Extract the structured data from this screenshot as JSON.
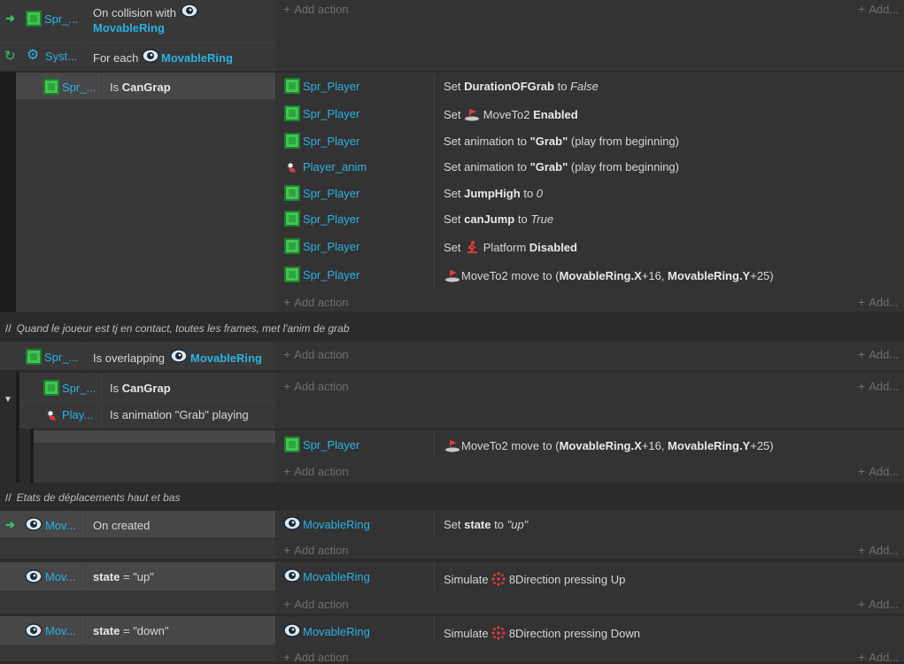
{
  "block1": {
    "trigger1": {
      "obj": "Spr_...",
      "text": "On collision with",
      "target": "MovableRing"
    },
    "trigger2": {
      "obj": "Syst...",
      "text": "For each",
      "target": "MovableRing"
    },
    "add_action": "Add action",
    "add_more": "Add..."
  },
  "sub1": {
    "cond_obj": "Spr_...",
    "cond_pre": "Is",
    "cond_var": "CanGrap",
    "actions": [
      {
        "obj": "Spr_Player",
        "icon": "sprite-icon",
        "pre": "Set",
        "a": "DurationOFGrab",
        "mid": "to",
        "b": "False"
      },
      {
        "obj": "Spr_Player",
        "icon": "sprite-icon",
        "pre": "Set",
        "beh": "MoveTo2",
        "b": "Enabled"
      },
      {
        "obj": "Spr_Player",
        "icon": "sprite-icon",
        "pre": "Set animation to",
        "a": "\"Grab\"",
        "post": "(play from beginning)"
      },
      {
        "obj": "Player_anim",
        "icon": "anim-icon",
        "pre": "Set animation to",
        "a": "\"Grab\"",
        "post": "(play from beginning)"
      },
      {
        "obj": "Spr_Player",
        "icon": "sprite-icon",
        "pre": "Set",
        "a": "JumpHigh",
        "mid": "to",
        "b": "0"
      },
      {
        "obj": "Spr_Player",
        "icon": "sprite-icon",
        "pre": "Set",
        "a": "canJump",
        "mid": "to",
        "b": "True"
      },
      {
        "obj": "Spr_Player",
        "icon": "sprite-icon",
        "pre": "Set",
        "beh": "Platform",
        "b": "Disabled"
      },
      {
        "obj": "Spr_Player",
        "icon": "sprite-icon",
        "beh": "MoveTo2",
        "pre": "move to (",
        "x": "MovableRing.X",
        "xo": "+16,",
        "y": "MovableRing.Y",
        "yo": "+25)"
      }
    ],
    "add_action": "Add action",
    "add_more": "Add..."
  },
  "comment1": {
    "slashes": "//",
    "text": "Quand le joueur est tj en contact, toutes les frames, met l'anim de grab"
  },
  "block2": {
    "cond_obj": "Spr_...",
    "cond_pre": "Is overlapping",
    "cond_target": "MovableRing",
    "add_action": "Add action",
    "add_more": "Add..."
  },
  "sub2": {
    "cond1_obj": "Spr_...",
    "cond1_pre": "Is",
    "cond1_var": "CanGrap",
    "cond2_obj": "Play...",
    "cond2_text": "Is animation \"Grab\" playing",
    "add_action": "Add action",
    "add_more": "Add..."
  },
  "sub3": {
    "action": {
      "obj": "Spr_Player",
      "beh": "MoveTo2",
      "pre": "move to (",
      "x": "MovableRing.X",
      "xo": "+16,",
      "y": "MovableRing.Y",
      "yo": "+25)"
    },
    "add_action": "Add action",
    "add_more": "Add..."
  },
  "comment2": {
    "slashes": "//",
    "text": "Etats de déplacements haut et bas"
  },
  "block3": {
    "cond_obj": "Mov...",
    "cond_text": "On created",
    "act_obj": "MovableRing",
    "act_pre": "Set",
    "act_var": "state",
    "act_mid": "to",
    "act_val": "\"up\"",
    "add_action": "Add action",
    "add_more": "Add..."
  },
  "block4": {
    "cond_obj": "Mov...",
    "cond_var": "state",
    "cond_eq": "= \"up\"",
    "act_obj": "MovableRing",
    "act_pre": "Simulate",
    "act_beh": "8Direction",
    "act_post": "pressing Up",
    "add_action": "Add action",
    "add_more": "Add..."
  },
  "block5": {
    "cond_obj": "Mov...",
    "cond_var": "state",
    "cond_eq": "= \"down\"",
    "act_obj": "MovableRing",
    "act_pre": "Simulate",
    "act_beh": "8Direction",
    "act_post": "pressing Down",
    "add_action": "Add action",
    "add_more": "Add..."
  },
  "colors": {
    "link": "#2ab1e3",
    "sprite": "#42c452",
    "trigger": "#36c46a",
    "behavior": "#e23b3b"
  }
}
